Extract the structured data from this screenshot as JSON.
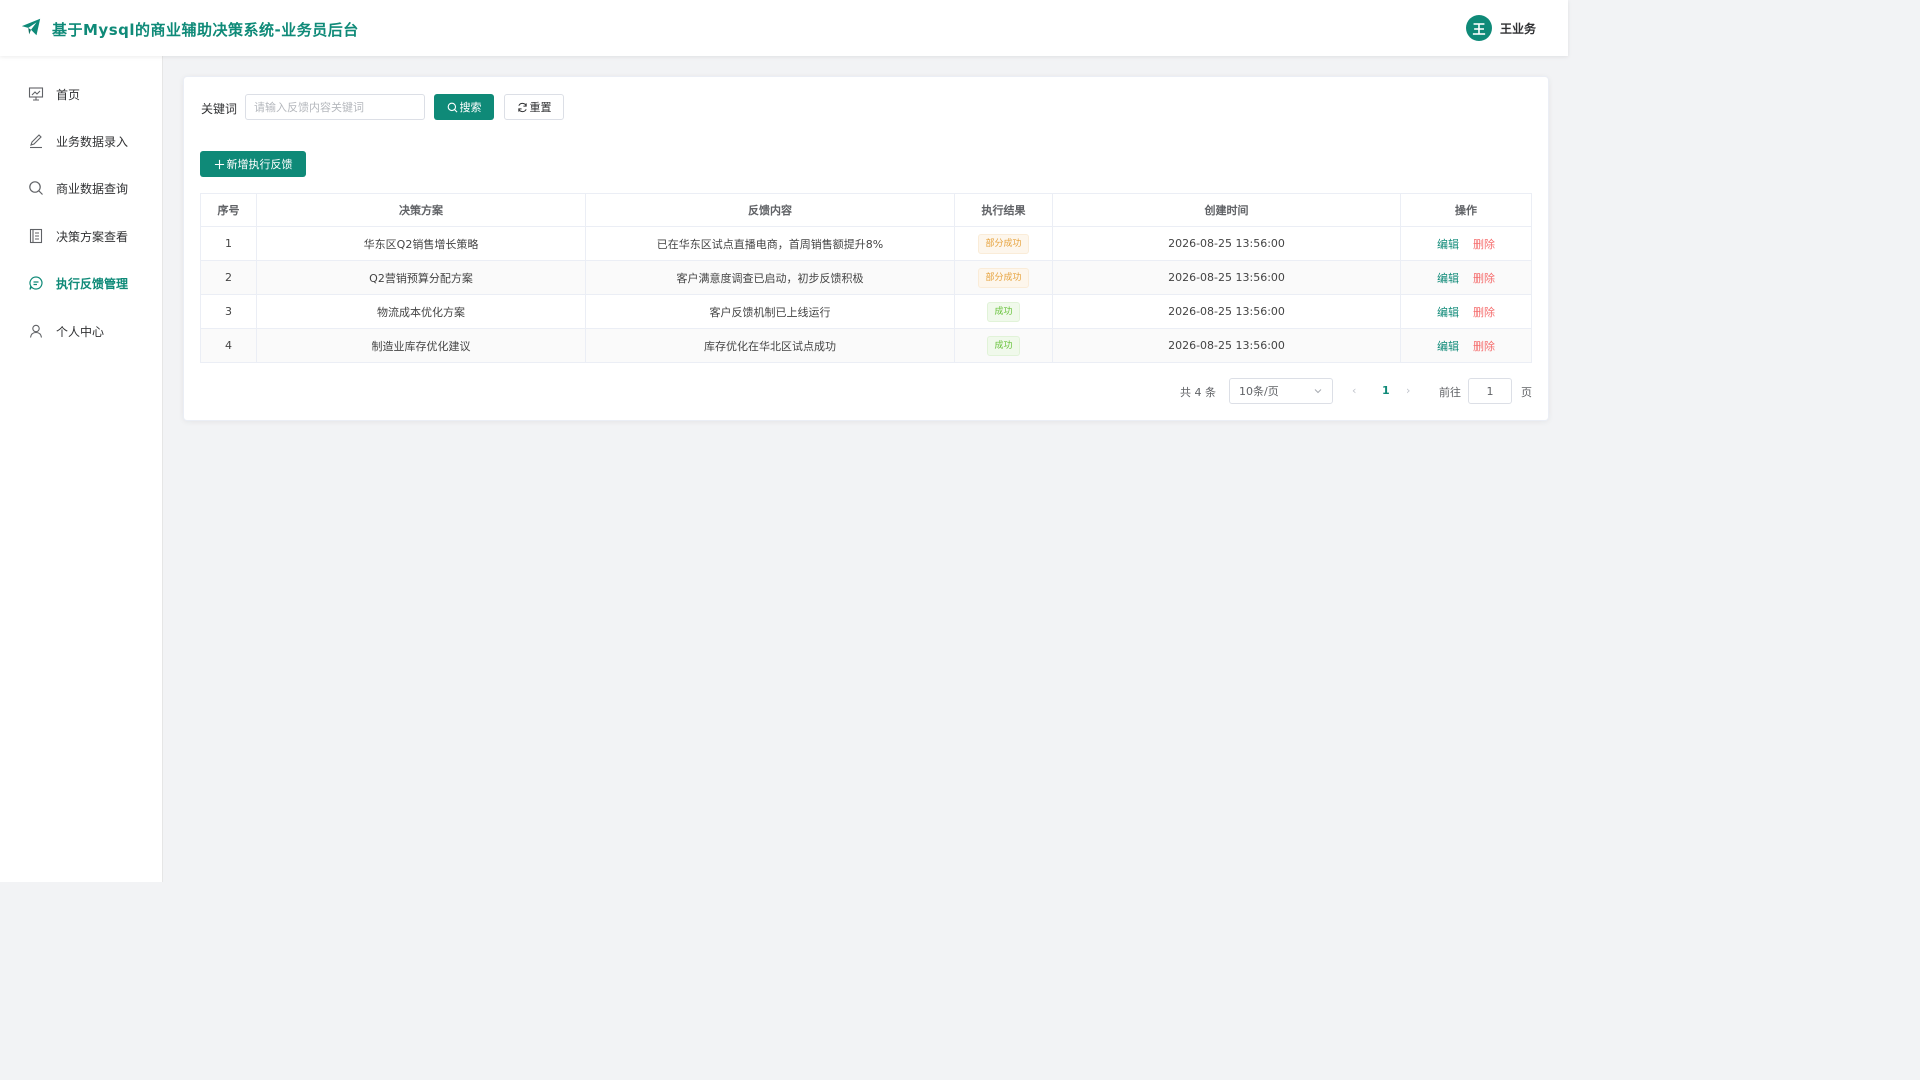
{
  "header": {
    "title": "基于Mysql的商业辅助决策系统-业务员后台",
    "user": {
      "avatar_text": "王",
      "name": "王业务"
    }
  },
  "sidebar": {
    "items": [
      {
        "label": "首页",
        "icon": "presentation-icon",
        "active": false
      },
      {
        "label": "业务数据录入",
        "icon": "pen-icon",
        "active": false
      },
      {
        "label": "商业数据查询",
        "icon": "search-icon",
        "active": false
      },
      {
        "label": "决策方案查看",
        "icon": "document-icon",
        "active": false
      },
      {
        "label": "执行反馈管理",
        "icon": "chat-icon",
        "active": true
      },
      {
        "label": "个人中心",
        "icon": "user-icon",
        "active": false
      }
    ]
  },
  "search": {
    "label": "关键词",
    "placeholder": "请输入反馈内容关键词",
    "search_button": "搜索",
    "reset_button": "重置"
  },
  "add_button": "新增执行反馈",
  "table": {
    "headers": [
      "序号",
      "决策方案",
      "反馈内容",
      "执行结果",
      "创建时间",
      "操作"
    ],
    "rows": [
      {
        "index": "1",
        "plan": "华东区Q2销售增长策略",
        "content": "已在华东区试点直播电商，首周销售额提升8%",
        "result": "部分成功",
        "result_type": "warning",
        "time": "2026-08-25 13:56:00"
      },
      {
        "index": "2",
        "plan": "Q2营销预算分配方案",
        "content": "客户满意度调查已启动，初步反馈积极",
        "result": "部分成功",
        "result_type": "warning",
        "time": "2026-08-25 13:56:00"
      },
      {
        "index": "3",
        "plan": "物流成本优化方案",
        "content": "客户反馈机制已上线运行",
        "result": "成功",
        "result_type": "success",
        "time": "2026-08-25 13:56:00"
      },
      {
        "index": "4",
        "plan": "制造业库存优化建议",
        "content": "库存优化在华北区试点成功",
        "result": "成功",
        "result_type": "success",
        "time": "2026-08-25 13:56:00"
      }
    ],
    "edit_label": "编辑",
    "delete_label": "删除"
  },
  "pagination": {
    "total_text": "共 4 条",
    "page_size": "10条/页",
    "current_page": "1",
    "goto_label": "前往",
    "goto_value": "1",
    "page_unit": "页"
  },
  "colors": {
    "primary": "#0f8a78",
    "danger": "#f56c6c",
    "warning": "#e6a23c",
    "success": "#67c23a"
  }
}
